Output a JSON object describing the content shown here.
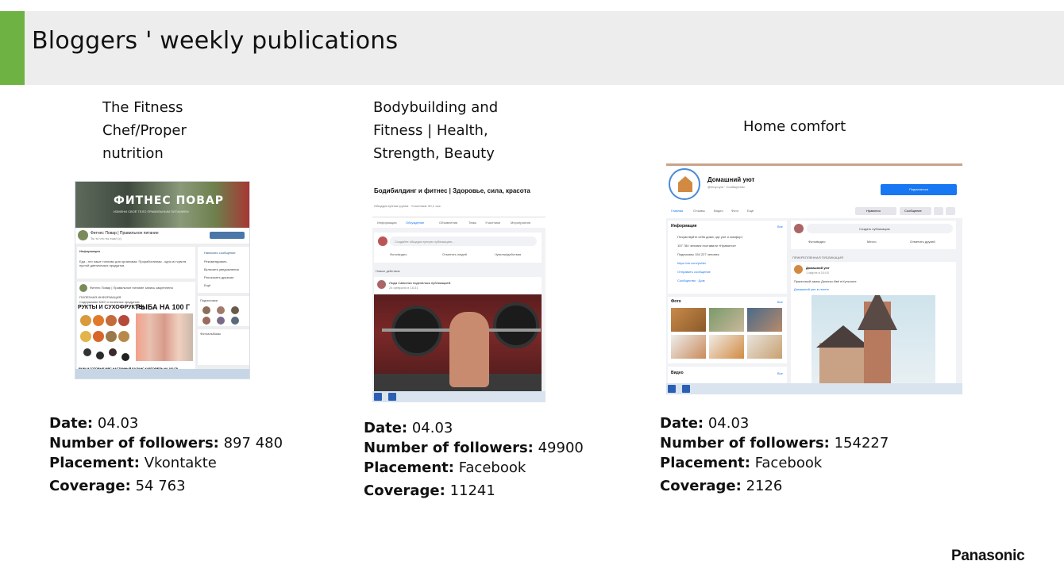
{
  "slide": {
    "title": "Bloggers ' weekly publications",
    "accent_color": "#6fb244",
    "brand": "Panasonic"
  },
  "bloggers": [
    {
      "title_lines": [
        "The Fitness",
        "Chef/Proper",
        "nutrition"
      ],
      "screenshot": {
        "cover_title": "ФИТНЕС ПОВАР",
        "cover_subtitle": "ИЗМЕНИ СВОЁ ТЕЛО ПРАВИЛЬНЫМ ПИТАНИЕМ",
        "group_name": "Фитнес Повар | Правильное питание",
        "group_status": "Ты то что ты ешь! (с)",
        "info_label": "Информация",
        "info_text": "Еда - это наше топливо для организма. Проработанная - одно из чувств пустой диетических продуктов",
        "post_author": "Фитнес Повар | Правильное питание запись закреплена",
        "post_text_1": "ПОЛЕЗНАЯ ИНФОРМАЦИЯ",
        "post_text_2": "Содержание БЖУ и полезных продуктов",
        "post_headline": "РУКТЫ И СУХОФРУКТЫ",
        "post_headline_2": "РЫБА НА 100 Г",
        "post_footer": "ЕКИИ И ГОТОВЫЕ МЯС ЧАСТИЧНЫЙ БАЛАНС КАРТОФЕЛЬ НА 100 ГР",
        "side_items": [
          "Написать сообщение",
          "Рекомендовать",
          "Включить уведомления",
          "Рассказать друзьям",
          "Ещё"
        ],
        "side_member_label": "Подписчики",
        "side_photos_label": "Фотоальбомы"
      },
      "stats": {
        "date_label": "Date:",
        "date": "04.03",
        "followers_label": "Number of followers:",
        "followers": "897 480",
        "placement_label": "Placement:",
        "placement": "Vkontakte",
        "coverage_label": "Coverage:",
        "coverage": "54 763"
      }
    },
    {
      "title_lines": [
        "Bodybuilding and",
        "Fitness | Health,",
        "Strength, Beauty"
      ],
      "screenshot": {
        "group_title": "Бодибилдинг и фитнес | Здоровье, сила, красота",
        "group_meta": "Общедоступная группа · Участники: 50,1 тыс.",
        "tabs": [
          "Информация",
          "Обсуждение",
          "Объявления",
          "Темы",
          "Участники",
          "Мероприятия"
        ],
        "composer_placeholder": "Создайте общедоступную публикацию...",
        "composer_actions": [
          "Фото/видео",
          "Отметить людей",
          "Чувства/действия"
        ],
        "new_activity": "Новые действия",
        "post_author": "Люда Савченко поделилась публикацией.",
        "post_date": "24 февраля в 16:31"
      },
      "stats": {
        "date_label": "Date:",
        "date": "04.03",
        "followers_label": "Number of followers:",
        "followers": "49900",
        "placement_label": "Placement:",
        "placement": "Facebook",
        "coverage_label": "Coverage:",
        "coverage": "11241"
      }
    },
    {
      "title_lines": [
        "Home comfort"
      ],
      "screenshot": {
        "page_name": "Домашний уют",
        "page_meta": "@moy.uyut · Сообщество",
        "subscribe_label": "Подписаться",
        "tabs": [
          "Главная",
          "Отзывы",
          "Видео",
          "Фото",
          "Ещё"
        ],
        "action_buttons": [
          "Нравится",
          "Сообщение"
        ],
        "info_title": "Информация",
        "info_lines": [
          "Почувствуйте себя дома, где уют и комфорт",
          "157 784 человек поставили «Нравится»",
          "Подписаны 154 227 человек",
          "https://vk.com/public",
          "Отправить сообщение",
          "Сообщество · Дом"
        ],
        "composer_label": "Создать публикацию",
        "composer_actions": [
          "Фото/видео",
          "Место",
          "Отметить друзей"
        ],
        "pinned_label": "ПРИКРЕПЛЕННАЯ ПУБЛИКАЦИЯ",
        "post_author": "Домашний уют",
        "post_date": "1 марта в 10:00",
        "post_text": "Пряничный замок Долины Ивё в Кульхоне",
        "post_link": "Домашний уют в телеге",
        "photos_label": "Фото",
        "video_label": "Видео",
        "all_label": "Все"
      },
      "stats": {
        "date_label": "Date:",
        "date": "04.03",
        "followers_label": "Number of followers:",
        "followers": "154227",
        "placement_label": "Placement:",
        "placement": "Facebook",
        "coverage_label": "Coverage:",
        "coverage": "2126"
      }
    }
  ]
}
